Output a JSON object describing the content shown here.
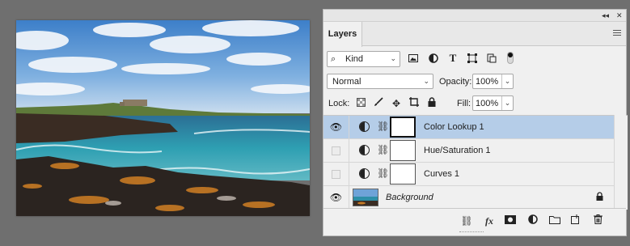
{
  "panel": {
    "collapse_glyph": "◂◂",
    "close_glyph": "✕",
    "tab_label": "Layers",
    "filter": {
      "kind_label": "Kind",
      "icons": [
        "image-filter-icon",
        "adjustment-filter-icon",
        "type-filter-icon",
        "shape-filter-icon",
        "smart-object-filter-icon"
      ]
    },
    "blend_mode": "Normal",
    "opacity_label": "Opacity:",
    "opacity_value": "100%",
    "lock_label": "Lock:",
    "fill_label": "Fill:",
    "fill_value": "100%"
  },
  "layers": [
    {
      "name": "Color Lookup 1",
      "visible": true,
      "selected": true,
      "type": "adjustment"
    },
    {
      "name": "Hue/Saturation 1",
      "visible": false,
      "selected": false,
      "type": "adjustment"
    },
    {
      "name": "Curves 1",
      "visible": false,
      "selected": false,
      "type": "adjustment"
    },
    {
      "name": "Background",
      "visible": true,
      "selected": false,
      "type": "image",
      "locked": true
    }
  ],
  "colors": {
    "selected_row": "#b5cde8",
    "panel_bg": "#f0f0f0",
    "workspace_bg": "#6f6f6f"
  }
}
